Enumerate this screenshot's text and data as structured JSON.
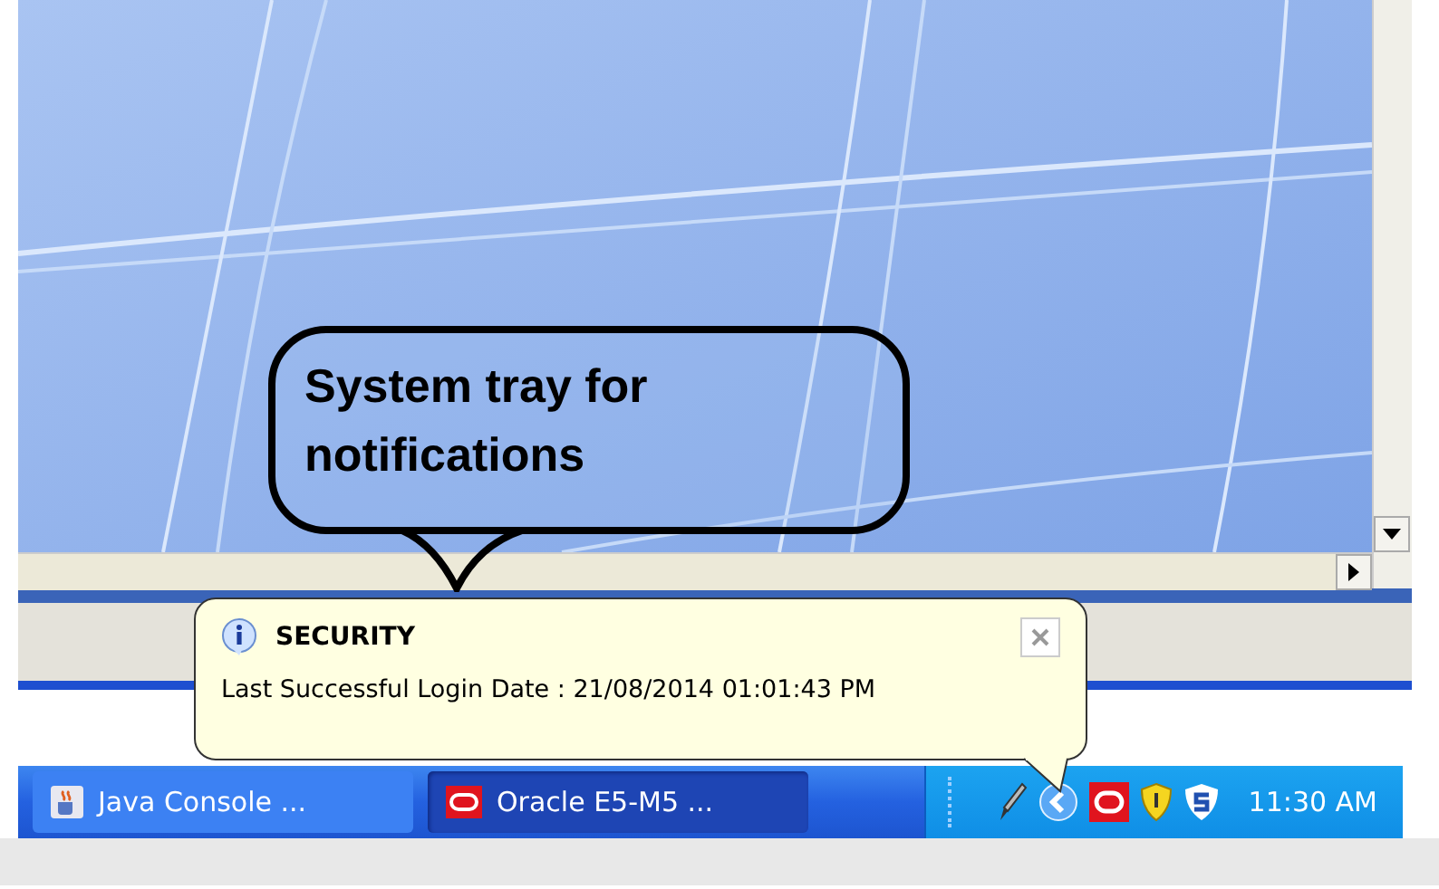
{
  "callout": {
    "text": "System tray for notifications"
  },
  "notification": {
    "title": "SECURITY",
    "message": "Last Successful Login Date : 21/08/2014 01:01:43 PM"
  },
  "taskbar": {
    "buttons": [
      {
        "label": "Java Console ...",
        "kind": "java",
        "selected": false
      },
      {
        "label": "Oracle E5-M5 ...",
        "kind": "oracle",
        "selected": true
      }
    ],
    "clock": "11:30 AM"
  }
}
